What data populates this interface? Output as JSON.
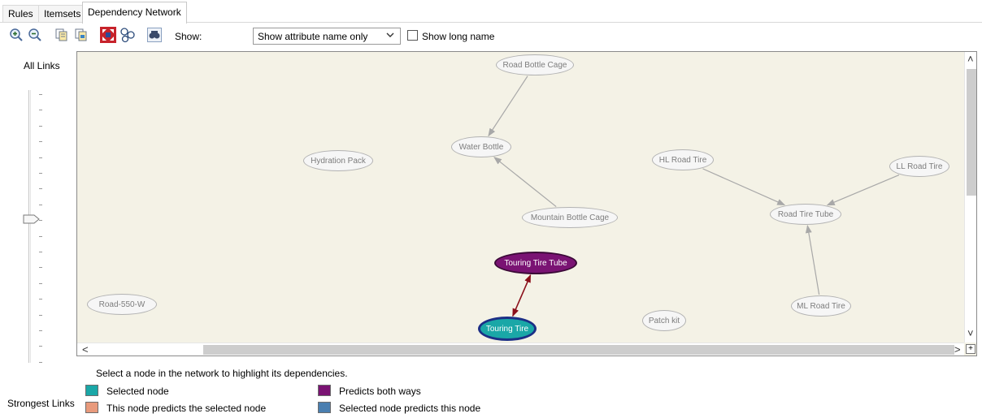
{
  "tabs": [
    {
      "label": "Rules",
      "active": false
    },
    {
      "label": "Itemsets",
      "active": false
    },
    {
      "label": "Dependency Network",
      "active": true
    }
  ],
  "toolbar": {
    "buttons": [
      "zoom-in-icon",
      "zoom-out-icon",
      "copy-icon",
      "copy-graph-icon",
      "fit-to-window-icon",
      "layout-icon",
      "find-node-icon"
    ],
    "show_label": "Show:",
    "show_select_value": "Show attribute name only",
    "show_long_name_label": "Show long name",
    "show_long_name_checked": false
  },
  "slider": {
    "label": "All Links",
    "bottom_label": "Strongest Links"
  },
  "network": {
    "nodes": [
      {
        "id": "road-bottle-cage",
        "label": "Road Bottle Cage",
        "state": "plain"
      },
      {
        "id": "water-bottle",
        "label": "Water Bottle",
        "state": "plain"
      },
      {
        "id": "hydration-pack",
        "label": "Hydration Pack",
        "state": "plain"
      },
      {
        "id": "hl-road-tire",
        "label": "HL Road Tire",
        "state": "plain"
      },
      {
        "id": "ll-road-tire",
        "label": "LL Road Tire",
        "state": "plain"
      },
      {
        "id": "mountain-bottle-cage",
        "label": "Mountain Bottle Cage",
        "state": "plain"
      },
      {
        "id": "road-tire-tube",
        "label": "Road Tire Tube",
        "state": "plain"
      },
      {
        "id": "touring-tire-tube",
        "label": "Touring Tire Tube",
        "state": "both"
      },
      {
        "id": "road-550-w",
        "label": "Road-550-W",
        "state": "plain"
      },
      {
        "id": "ml-road-tire",
        "label": "ML Road Tire",
        "state": "plain"
      },
      {
        "id": "patch-kit",
        "label": "Patch kit",
        "state": "plain"
      },
      {
        "id": "touring-tire",
        "label": "Touring Tire",
        "state": "selected"
      }
    ],
    "links": [
      {
        "from": "road-bottle-cage",
        "to": "water-bottle",
        "type": "normal"
      },
      {
        "from": "mountain-bottle-cage",
        "to": "water-bottle",
        "type": "normal"
      },
      {
        "from": "hl-road-tire",
        "to": "road-tire-tube",
        "type": "normal"
      },
      {
        "from": "ll-road-tire",
        "to": "road-tire-tube",
        "type": "normal"
      },
      {
        "from": "ml-road-tire",
        "to": "road-tire-tube",
        "type": "normal"
      },
      {
        "from": "touring-tire",
        "to": "touring-tire-tube",
        "type": "both-ways"
      }
    ]
  },
  "hint": "Select a node in the network to highlight its dependencies.",
  "legend": {
    "items": [
      {
        "label": "Selected node",
        "color": "#1aa7a7"
      },
      {
        "label": "This node predicts the selected node",
        "color": "#e89a7c"
      },
      {
        "label": "Predicts both ways",
        "color": "#7a1373"
      },
      {
        "label": "Selected node predicts this node",
        "color": "#4a7fb0"
      }
    ]
  },
  "colors": {
    "canvas_background": "#f4f2e6",
    "link_normal": "#a8a8a8",
    "link_both_ways": "#8b0f1a"
  }
}
